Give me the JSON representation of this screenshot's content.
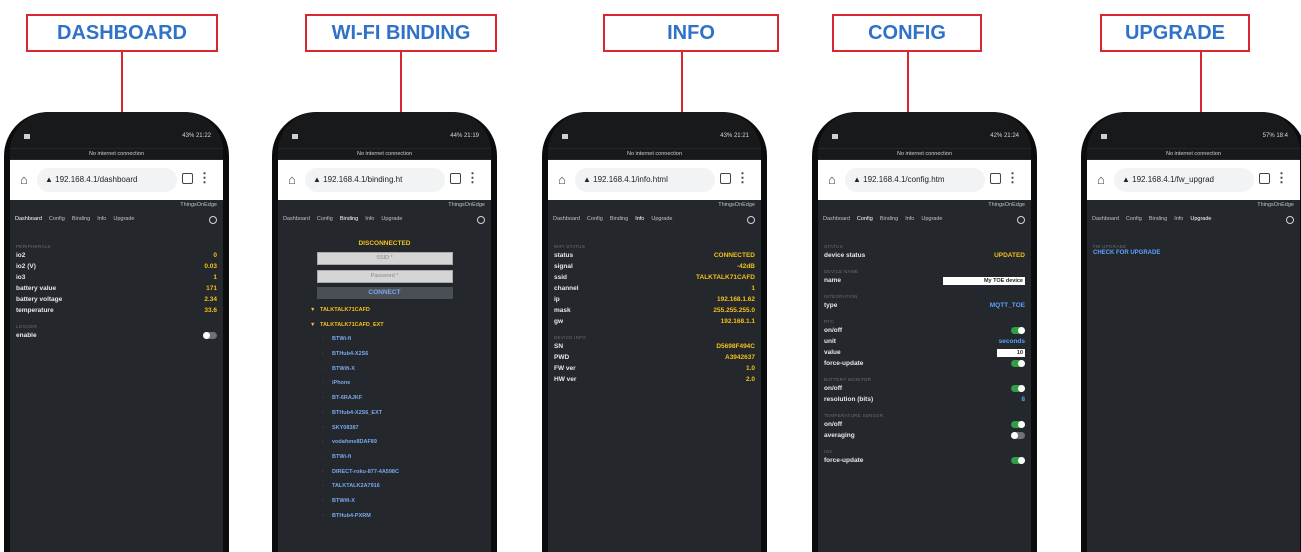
{
  "labels": [
    "DASHBOARD",
    "WI-FI BINDING",
    "INFO",
    "CONFIG",
    "UPGRADE"
  ],
  "accent_red": "#d9262f",
  "accent_blue": "#2f72c8",
  "tabs": [
    "Dashboard",
    "Config",
    "Binding",
    "Info",
    "Upgrade"
  ],
  "brand": "ThingsOnEdge",
  "no_internet": "No internet connection",
  "icons": {
    "home": "home-icon",
    "warning": "warning-icon",
    "tabs": "tabs-icon",
    "menu": "menu-icon",
    "power": "power-icon"
  },
  "phones": [
    {
      "status_right": "43% 21:22",
      "url": "192.168.4.1/dashboard",
      "tab_count": "",
      "sections": [
        {
          "title": "PERIPHERALS",
          "rows": [
            {
              "k": "io2",
              "v": "0"
            },
            {
              "k": "io2 (V)",
              "v": "0.03"
            },
            {
              "k": "io3",
              "v": "1"
            },
            {
              "k": "battery value",
              "v": "171"
            },
            {
              "k": "battery voltage",
              "v": "2.34"
            },
            {
              "k": "temperature",
              "v": "33.6"
            }
          ]
        },
        {
          "title": "LOGGER",
          "rows": [
            {
              "k": "enable",
              "toggle": "off"
            }
          ]
        }
      ]
    },
    {
      "status_right": "44% 21:19",
      "url": "192.168.4.1/binding.ht",
      "tab_count": "",
      "disconnected": "DISCONNECTED",
      "ssid_placeholder": "SSID *",
      "password_placeholder": "Password *",
      "connect": "CONNECT",
      "networks": [
        {
          "name": "TALKTALK71CAFD",
          "fav": true
        },
        {
          "name": "TALKTALK71CAFD_EXT",
          "fav": true
        },
        {
          "name": "BTWi-fi",
          "fav": false
        },
        {
          "name": "BTHub4-X2S6",
          "fav": false
        },
        {
          "name": "BTWifi-X",
          "fav": false
        },
        {
          "name": "iPhone",
          "fav": false
        },
        {
          "name": "BT-6RAJKF",
          "fav": false
        },
        {
          "name": "BTHub4-X2S6_EXT",
          "fav": false
        },
        {
          "name": "SKY08387",
          "fav": false
        },
        {
          "name": "vodafone8DAF89",
          "fav": false
        },
        {
          "name": "BTWi-fi",
          "fav": false
        },
        {
          "name": "DIRECT-roku-877-4A598C",
          "fav": false
        },
        {
          "name": "TALKTALK2A7916",
          "fav": false
        },
        {
          "name": "BTWifi-X",
          "fav": false
        },
        {
          "name": "BTHub4-PXRM",
          "fav": false
        }
      ]
    },
    {
      "status_right": "43% 21:21",
      "url": "192.168.4.1/info.html",
      "tab_count": "",
      "sections": [
        {
          "title": "WIFI STATUS",
          "rows": [
            {
              "k": "status",
              "v": "CONNECTED"
            },
            {
              "k": "signal",
              "v": "-42dB"
            },
            {
              "k": "ssid",
              "v": "TALKTALK71CAFD"
            },
            {
              "k": "channel",
              "v": "1"
            },
            {
              "k": "ip",
              "v": "192.168.1.62"
            },
            {
              "k": "mask",
              "v": "255.255.255.0"
            },
            {
              "k": "gw",
              "v": "192.168.1.1"
            }
          ]
        },
        {
          "title": "DEVICE INFO",
          "rows": [
            {
              "k": "SN",
              "v": "D5698F494C"
            },
            {
              "k": "PWD",
              "v": "A3942637"
            },
            {
              "k": "FW ver",
              "v": "1.0"
            },
            {
              "k": "HW ver",
              "v": "2.0"
            }
          ]
        }
      ]
    },
    {
      "status_right": "42% 21:24",
      "url": "192.168.4.1/config.htm",
      "tab_count": "",
      "sections": [
        {
          "title": "STATUS",
          "rows": [
            {
              "k": "device status",
              "v": "UPDATED"
            }
          ]
        },
        {
          "title": "DEVICE NAME",
          "rows": [
            {
              "k": "name",
              "input": "My TOE device"
            }
          ]
        },
        {
          "title": "INTEGRATION",
          "rows": [
            {
              "k": "type",
              "vb": "MQTT_TOE"
            }
          ]
        },
        {
          "title": "RTC",
          "rows": [
            {
              "k": "on/off",
              "toggle": "on"
            },
            {
              "k": "unit",
              "vb": "seconds"
            },
            {
              "k": "value",
              "input": "10"
            },
            {
              "k": "force-update",
              "toggle": "on"
            }
          ]
        },
        {
          "title": "BATTERY MONITOR",
          "rows": [
            {
              "k": "on/off",
              "toggle": "on"
            },
            {
              "k": "resolution (bits)",
              "vb": "8"
            }
          ]
        },
        {
          "title": "TEMPERATURE SENSOR",
          "rows": [
            {
              "k": "on/off",
              "toggle": "on"
            },
            {
              "k": "averaging",
              "toggle": "off"
            }
          ]
        },
        {
          "title": "IO2",
          "rows": [
            {
              "k": "force-update",
              "toggle": "on"
            }
          ]
        }
      ]
    },
    {
      "status_right": "57% 18:4",
      "url": "192.168.4.1/fw_upgrad",
      "tab_count": "",
      "sections": [
        {
          "title": "FW UPGRADE",
          "rows": []
        }
      ],
      "check": "CHECK FOR UPGRADE"
    }
  ]
}
